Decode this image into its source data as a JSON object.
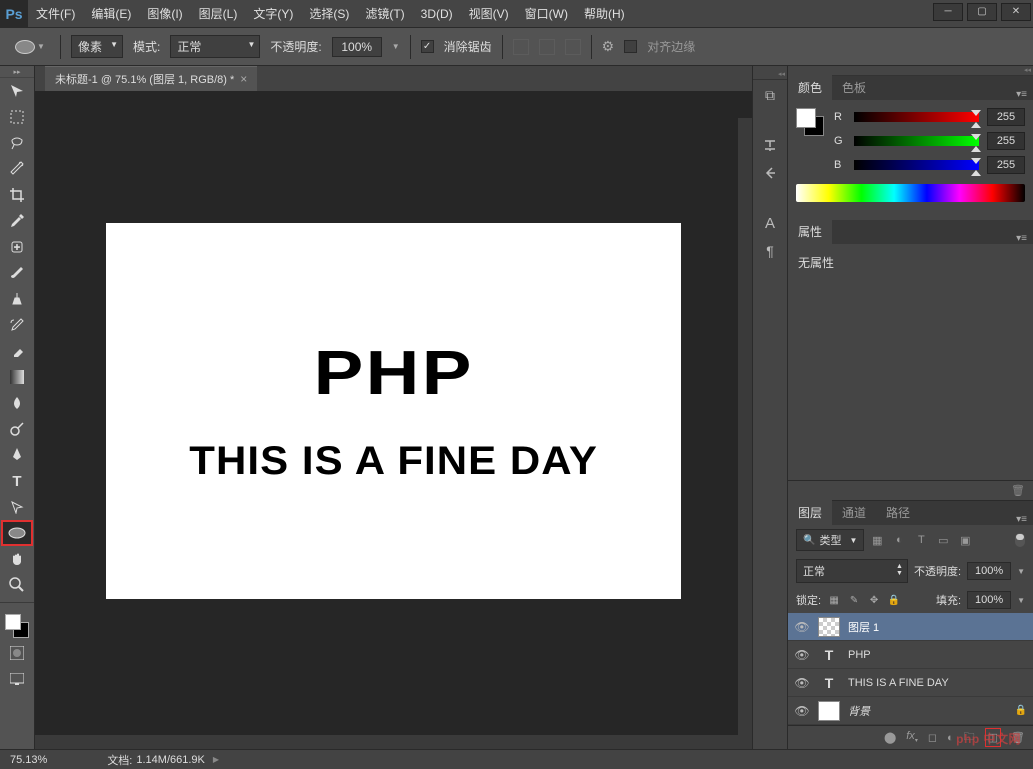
{
  "app": {
    "logo": "Ps"
  },
  "menu": {
    "file": "文件(F)",
    "edit": "编辑(E)",
    "image": "图像(I)",
    "layer": "图层(L)",
    "type": "文字(Y)",
    "select": "选择(S)",
    "filter": "滤镜(T)",
    "threed": "3D(D)",
    "view": "视图(V)",
    "window": "窗口(W)",
    "help": "帮助(H)"
  },
  "options": {
    "shape_dropdown": "像素",
    "mode_label": "模式:",
    "mode_value": "正常",
    "opacity_label": "不透明度:",
    "opacity_value": "100%",
    "antialias_label": "消除锯齿",
    "align_label": "对齐边缘"
  },
  "document": {
    "tab_title": "未标题-1 @ 75.1% (图层 1, RGB/8) *",
    "text_1": "PHP",
    "text_2": "THIS IS A FINE DAY"
  },
  "panels": {
    "color": {
      "tab_color": "颜色",
      "tab_swatches": "色板",
      "r": "R",
      "g": "G",
      "b": "B",
      "r_val": "255",
      "g_val": "255",
      "b_val": "255"
    },
    "properties": {
      "tab": "属性",
      "content": "无属性"
    },
    "layers": {
      "tab_layers": "图层",
      "tab_channels": "通道",
      "tab_paths": "路径",
      "filter_type": "类型",
      "blend_mode": "正常",
      "opacity_label": "不透明度:",
      "opacity_val": "100%",
      "lock_label": "锁定:",
      "fill_label": "填充:",
      "fill_val": "100%",
      "items": [
        {
          "name": "图层 1",
          "type": "checker",
          "selected": true
        },
        {
          "name": "PHP",
          "type": "text"
        },
        {
          "name": "THIS IS A FINE DAY",
          "type": "text"
        },
        {
          "name": "背景",
          "type": "white",
          "locked": true,
          "italic": true
        }
      ]
    }
  },
  "status": {
    "zoom": "75.13%",
    "doc_label": "文档:",
    "doc_size": "1.14M/661.9K"
  },
  "watermark": "php 中文网"
}
